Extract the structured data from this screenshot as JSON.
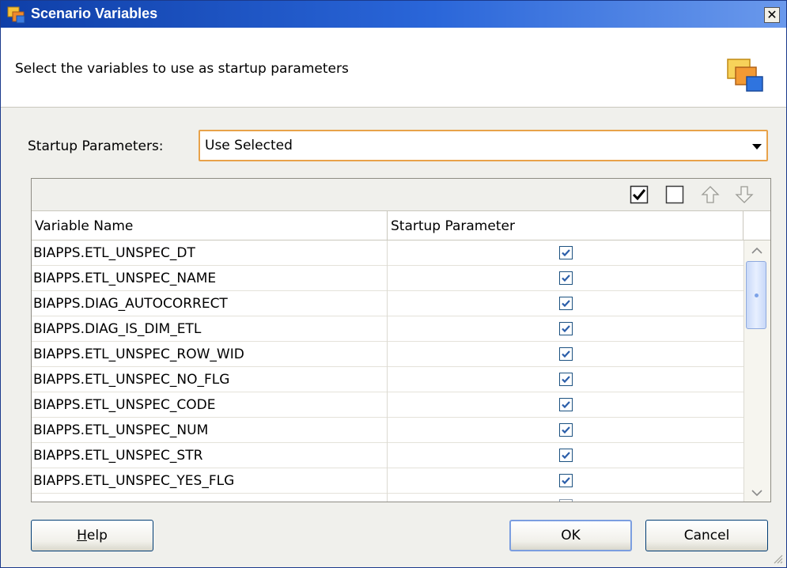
{
  "window": {
    "title": "Scenario Variables",
    "close_glyph": "✕"
  },
  "header": {
    "instruction": "Select the variables to use as startup parameters",
    "icon": "scenario-icon"
  },
  "startup": {
    "label": "Startup Parameters:",
    "selected": "Use Selected"
  },
  "toolbar": {
    "icons": [
      "check-all-icon",
      "uncheck-all-icon",
      "move-up-icon",
      "move-down-icon"
    ]
  },
  "table": {
    "columns": [
      "Variable Name",
      "Startup Parameter"
    ],
    "rows": [
      {
        "name": "BIAPPS.ETL_UNSPEC_DT",
        "checked": true
      },
      {
        "name": "BIAPPS.ETL_UNSPEC_NAME",
        "checked": true
      },
      {
        "name": "BIAPPS.DIAG_AUTOCORRECT",
        "checked": true
      },
      {
        "name": "BIAPPS.DIAG_IS_DIM_ETL",
        "checked": true
      },
      {
        "name": "BIAPPS.ETL_UNSPEC_ROW_WID",
        "checked": true
      },
      {
        "name": "BIAPPS.ETL_UNSPEC_NO_FLG",
        "checked": true
      },
      {
        "name": "BIAPPS.ETL_UNSPEC_CODE",
        "checked": true
      },
      {
        "name": "BIAPPS.ETL_UNSPEC_NUM",
        "checked": true
      },
      {
        "name": "BIAPPS.ETL_UNSPEC_STR",
        "checked": true
      },
      {
        "name": "BIAPPS.ETL_UNSPEC_YES_FLG",
        "checked": true
      }
    ]
  },
  "buttons": {
    "help_mnemonic": "H",
    "help_rest": "elp",
    "ok": "OK",
    "cancel": "Cancel"
  },
  "colors": {
    "title_bar": "#2a66d9",
    "focus_border": "#e8a24a",
    "check_mark": "#2b5ea9"
  }
}
